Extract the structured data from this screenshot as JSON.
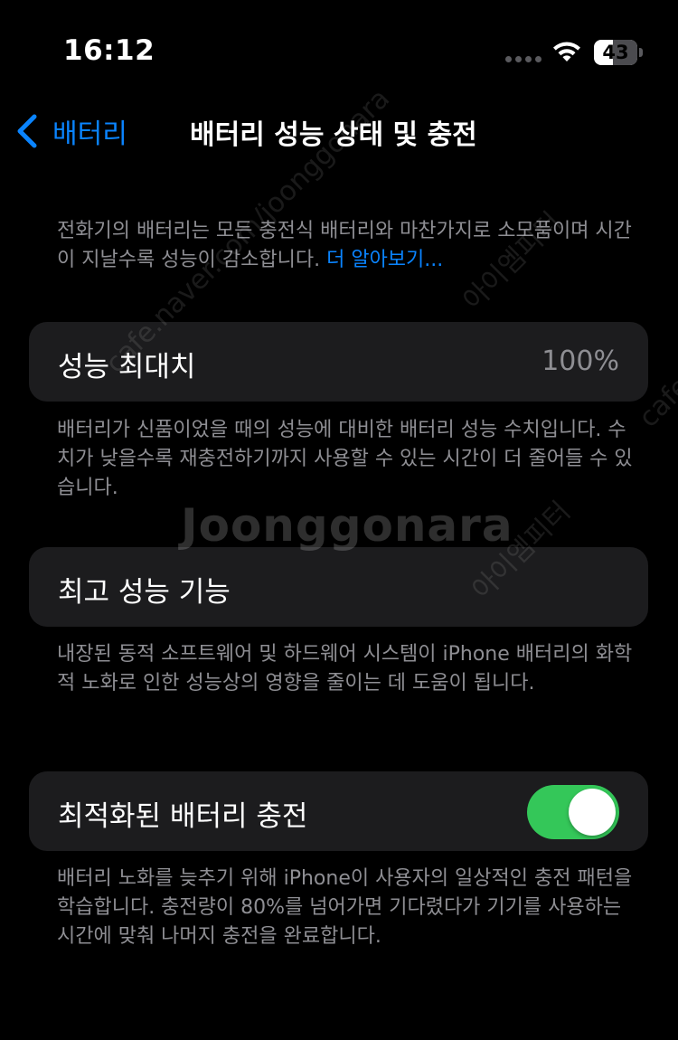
{
  "status_bar": {
    "time": "16:12",
    "battery_level": "43",
    "battery_fraction": 0.43
  },
  "nav": {
    "back_label": "배터리",
    "title": "배터리 성능 상태 및 충전"
  },
  "intro": {
    "text": "전화기의 배터리는 모든 충전식 배터리와 마찬가지로 소모품이며 시간이 지날수록 성능이 감소합니다. ",
    "link": "더 알아보기..."
  },
  "max_capacity": {
    "label": "성능 최대치",
    "value": "100%",
    "footer": "배터리가 신품이었을 때의 성능에 대비한 배터리 성능 수치입니다. 수치가 낮을수록 재충전하기까지 사용할 수 있는 시간이 더 줄어들 수 있습니다."
  },
  "peak_performance": {
    "label": "최고 성능 기능",
    "footer": "내장된 동적 소프트웨어 및 하드웨어 시스템이 iPhone 배터리의 화학적 노화로 인한 성능상의 영향을 줄이는 데 도움이 됩니다."
  },
  "optimized_charging": {
    "label": "최적화된 배터리 충전",
    "enabled": true,
    "footer": "배터리 노화를 늦추기 위해 iPhone이 사용자의 일상적인 충전 패턴을 학습합니다. 충전량이 80%를 넘어가면 기다렸다가 기기를 사용하는 시간에 맞춰 나머지 충전을 완료합니다."
  },
  "watermark": {
    "main": "Joonggonara",
    "url": "cafe.naver.com/joonggonara",
    "seller": "아이엠피터",
    "edge": "cafe.n"
  },
  "colors": {
    "background": "#000000",
    "cell": "#1c1c1e",
    "accent": "#0a84ff",
    "toggle_on": "#34c759",
    "secondary_text": "#8e8e93"
  }
}
